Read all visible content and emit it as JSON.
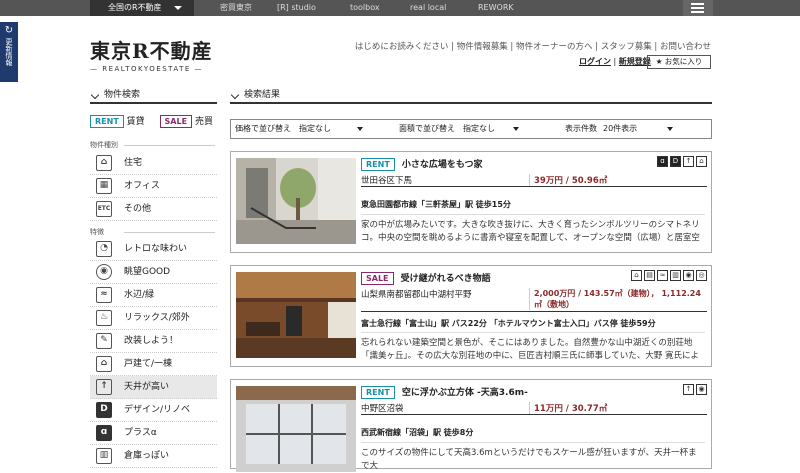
{
  "topbar": {
    "region": "全国のR不動産",
    "links": [
      "密買東京",
      "[R] studio",
      "toolbox",
      "real local",
      "REWORK"
    ]
  },
  "sidetab": {
    "label": "更新情報"
  },
  "logo": {
    "jp": "東京R不動産",
    "en": "— REALTOKYOESTATE —"
  },
  "nav": {
    "links": "はじめにお読みください | 物件情報募集 | 物件オーナーの方へ | スタッフ募集 | お問い合わせ",
    "login": "ログイン",
    "register": "新規登録",
    "favorites": "★ お気に入り"
  },
  "sidebar": {
    "search_title": "物件検索",
    "rent": "RENT",
    "rent_label": "賃貸",
    "sale": "SALE",
    "sale_label": "売買",
    "type_group": "物件種別",
    "types": [
      {
        "label": "住宅",
        "icon": "house-icon"
      },
      {
        "label": "オフィス",
        "icon": "building-icon"
      },
      {
        "label": "その他",
        "icon": "etc-icon"
      }
    ],
    "feature_group": "特徴",
    "features": [
      {
        "label": "レトロな味わい",
        "icon": "retro-icon"
      },
      {
        "label": "眺望GOOD",
        "icon": "eye-icon"
      },
      {
        "label": "水辺/緑",
        "icon": "waterside-icon"
      },
      {
        "label": "リラックス/郊外",
        "icon": "bath-icon"
      },
      {
        "label": "改装しよう！",
        "icon": "renovate-icon"
      },
      {
        "label": "戸建て/一棟",
        "icon": "detached-house-icon"
      },
      {
        "label": "天井が高い",
        "icon": "high-ceiling-icon"
      },
      {
        "label": "デザイン/リノベ",
        "icon": "design-icon"
      },
      {
        "label": "プラスα",
        "icon": "plus-alpha-icon"
      },
      {
        "label": "倉庫っぽい",
        "icon": "warehouse-icon"
      }
    ]
  },
  "results": {
    "title": "検索結果",
    "sort_price": "価格で並び替え　指定なし",
    "sort_area": "面積で並び替え　指定なし",
    "count_label": "表示件数",
    "count_value": "20件表示"
  },
  "listings": [
    {
      "tag": "RENT",
      "title": "小さな広場をもつ家",
      "location": "世田谷区下馬",
      "price": "39万円 / 50.96㎡",
      "station": "東急田園都市線「三軒茶屋」駅 徒歩15分",
      "desc": "家の中が広場みたいです。大きな吹き抜けに、大きく育ったシンボルツリーのシマトネリコ。中央の空間を眺めるように書斎や寝室を配置して、オープンな空間（広場）と居室空",
      "icons": [
        "ɑ",
        "D",
        "↑",
        "⌂"
      ]
    },
    {
      "tag": "SALE",
      "title": "受け継がれるべき物語",
      "location": "山梨県南都留郡山中湖村平野",
      "price": "2,000万円 / 143.57㎡（建物）， 1,112.24㎡（敷地）",
      "station": "富士急行線「富士山」駅 バス22分 「ホテルマウント富士入口」バス停 徒歩59分",
      "desc": "忘れられない建築空間と景色が、そこにはありました。自然豊かな山中湖近くの別荘地「識美ヶ丘」。その広大な別荘地の中に、巨匠吉村順三氏に師事していた、大野 寛氏によ",
      "icons": [
        "⌂",
        "▤",
        "≈",
        "▥",
        "◉",
        "◎"
      ]
    },
    {
      "tag": "RENT",
      "title": "空に浮かぶ立方体 -天高3.6m-",
      "location": "中野区沼袋",
      "price": "11万円 / 30.77㎡",
      "station": "西武新宿線「沼袋」駅 徒歩8分",
      "desc": "このサイズの物件にして天高3.6mというだけでもスケール感が狂いますが、天井一杯まで大",
      "icons": [
        "↑",
        "◉"
      ]
    }
  ]
}
